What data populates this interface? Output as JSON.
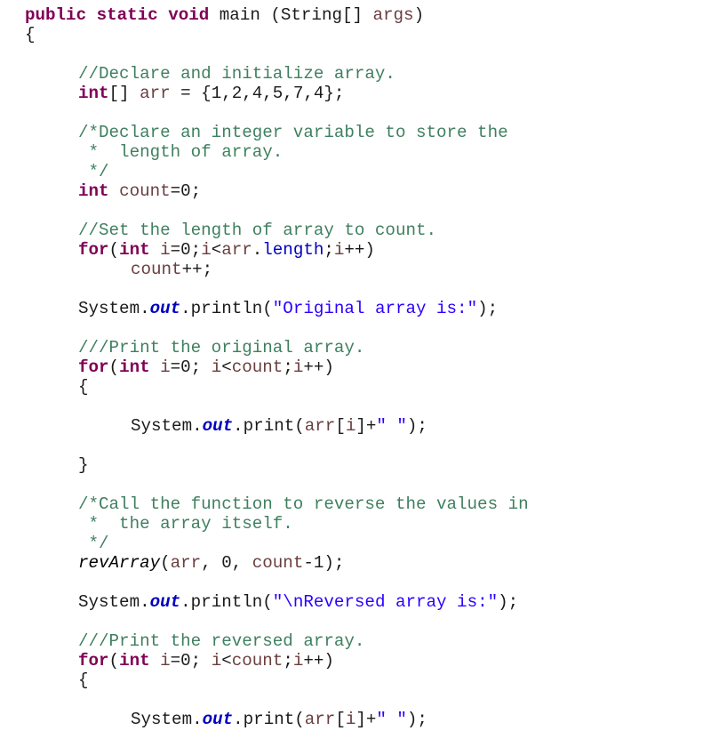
{
  "editor": {
    "language": "java",
    "colors": {
      "keyword": "#7F0055",
      "comment": "#3F7F5F",
      "string": "#2A00FF",
      "field": "#0000C0",
      "local_variable": "#6A3E3E",
      "plain": "#000000",
      "background": "#FFFFFF"
    },
    "lines": [
      {
        "indent": 0,
        "tokens": [
          [
            "keyword",
            "public"
          ],
          [
            "plain",
            " "
          ],
          [
            "keyword",
            "static"
          ],
          [
            "plain",
            " "
          ],
          [
            "keyword",
            "void"
          ],
          [
            "plain",
            " main (String[] "
          ],
          [
            "local",
            "args"
          ],
          [
            "plain",
            ")"
          ]
        ]
      },
      {
        "indent": 0,
        "tokens": [
          [
            "plain",
            "{"
          ]
        ]
      },
      {
        "indent": 0,
        "tokens": []
      },
      {
        "indent": 1,
        "tokens": [
          [
            "comment",
            "//Declare and initialize array."
          ]
        ]
      },
      {
        "indent": 1,
        "tokens": [
          [
            "keyword",
            "int"
          ],
          [
            "plain",
            "[] "
          ],
          [
            "local",
            "arr"
          ],
          [
            "plain",
            " = {1,2,4,5,7,4};"
          ]
        ]
      },
      {
        "indent": 1,
        "tokens": []
      },
      {
        "indent": 1,
        "tokens": [
          [
            "comment",
            "/*Declare an integer variable to store the"
          ]
        ]
      },
      {
        "indent": 1,
        "tokens": [
          [
            "comment",
            " *  length of array."
          ]
        ]
      },
      {
        "indent": 1,
        "tokens": [
          [
            "comment",
            " */"
          ]
        ]
      },
      {
        "indent": 1,
        "tokens": [
          [
            "keyword",
            "int"
          ],
          [
            "plain",
            " "
          ],
          [
            "local",
            "count"
          ],
          [
            "plain",
            "=0;"
          ]
        ]
      },
      {
        "indent": 1,
        "tokens": []
      },
      {
        "indent": 1,
        "tokens": [
          [
            "comment",
            "//Set the length of array to count."
          ]
        ]
      },
      {
        "indent": 1,
        "tokens": [
          [
            "keyword",
            "for"
          ],
          [
            "plain",
            "("
          ],
          [
            "keyword",
            "int"
          ],
          [
            "plain",
            " "
          ],
          [
            "local",
            "i"
          ],
          [
            "plain",
            "=0;"
          ],
          [
            "local",
            "i"
          ],
          [
            "plain",
            "<"
          ],
          [
            "local",
            "arr"
          ],
          [
            "plain",
            "."
          ],
          [
            "field",
            "length"
          ],
          [
            "plain",
            ";"
          ],
          [
            "local",
            "i"
          ],
          [
            "plain",
            "++)"
          ]
        ]
      },
      {
        "indent": 2,
        "tokens": [
          [
            "local",
            "count"
          ],
          [
            "plain",
            "++;"
          ]
        ]
      },
      {
        "indent": 1,
        "tokens": []
      },
      {
        "indent": 1,
        "tokens": [
          [
            "plain",
            "System."
          ],
          [
            "field-static",
            "out"
          ],
          [
            "plain",
            ".println("
          ],
          [
            "string",
            "\"Original array is:\""
          ],
          [
            "plain",
            ");"
          ]
        ]
      },
      {
        "indent": 1,
        "tokens": []
      },
      {
        "indent": 1,
        "tokens": [
          [
            "comment",
            "///Print the original array."
          ]
        ]
      },
      {
        "indent": 1,
        "tokens": [
          [
            "keyword",
            "for"
          ],
          [
            "plain",
            "("
          ],
          [
            "keyword",
            "int"
          ],
          [
            "plain",
            " "
          ],
          [
            "local",
            "i"
          ],
          [
            "plain",
            "=0; "
          ],
          [
            "local",
            "i"
          ],
          [
            "plain",
            "<"
          ],
          [
            "local",
            "count"
          ],
          [
            "plain",
            ";"
          ],
          [
            "local",
            "i"
          ],
          [
            "plain",
            "++)"
          ]
        ]
      },
      {
        "indent": 1,
        "tokens": [
          [
            "plain",
            "{"
          ]
        ]
      },
      {
        "indent": 1,
        "tokens": []
      },
      {
        "indent": 2,
        "tokens": [
          [
            "plain",
            "System."
          ],
          [
            "field-static",
            "out"
          ],
          [
            "plain",
            ".print("
          ],
          [
            "local",
            "arr"
          ],
          [
            "plain",
            "["
          ],
          [
            "local",
            "i"
          ],
          [
            "plain",
            "]+"
          ],
          [
            "string",
            "\" \""
          ],
          [
            "plain",
            ");"
          ]
        ]
      },
      {
        "indent": 1,
        "tokens": []
      },
      {
        "indent": 1,
        "tokens": [
          [
            "plain",
            "}"
          ]
        ]
      },
      {
        "indent": 1,
        "tokens": []
      },
      {
        "indent": 1,
        "tokens": [
          [
            "comment",
            "/*Call the function to reverse the values in"
          ]
        ]
      },
      {
        "indent": 1,
        "tokens": [
          [
            "comment",
            " *  the array itself."
          ]
        ]
      },
      {
        "indent": 1,
        "tokens": [
          [
            "comment",
            " */"
          ]
        ]
      },
      {
        "indent": 1,
        "tokens": [
          [
            "method-static",
            "revArray"
          ],
          [
            "plain",
            "("
          ],
          [
            "local",
            "arr"
          ],
          [
            "plain",
            ", 0, "
          ],
          [
            "local",
            "count"
          ],
          [
            "plain",
            "-1);"
          ]
        ]
      },
      {
        "indent": 1,
        "tokens": []
      },
      {
        "indent": 1,
        "tokens": [
          [
            "plain",
            "System."
          ],
          [
            "field-static",
            "out"
          ],
          [
            "plain",
            ".println("
          ],
          [
            "string",
            "\"\\nReversed array is:\""
          ],
          [
            "plain",
            ");"
          ]
        ]
      },
      {
        "indent": 1,
        "tokens": []
      },
      {
        "indent": 1,
        "tokens": [
          [
            "comment",
            "///Print the reversed array."
          ]
        ]
      },
      {
        "indent": 1,
        "tokens": [
          [
            "keyword",
            "for"
          ],
          [
            "plain",
            "("
          ],
          [
            "keyword",
            "int"
          ],
          [
            "plain",
            " "
          ],
          [
            "local",
            "i"
          ],
          [
            "plain",
            "=0; "
          ],
          [
            "local",
            "i"
          ],
          [
            "plain",
            "<"
          ],
          [
            "local",
            "count"
          ],
          [
            "plain",
            ";"
          ],
          [
            "local",
            "i"
          ],
          [
            "plain",
            "++)"
          ]
        ]
      },
      {
        "indent": 1,
        "tokens": [
          [
            "plain",
            "{"
          ]
        ]
      },
      {
        "indent": 1,
        "tokens": []
      },
      {
        "indent": 2,
        "tokens": [
          [
            "plain",
            "System."
          ],
          [
            "field-static",
            "out"
          ],
          [
            "plain",
            ".print("
          ],
          [
            "local",
            "arr"
          ],
          [
            "plain",
            "["
          ],
          [
            "local",
            "i"
          ],
          [
            "plain",
            "]+"
          ],
          [
            "string",
            "\" \""
          ],
          [
            "plain",
            ");"
          ]
        ]
      }
    ]
  }
}
